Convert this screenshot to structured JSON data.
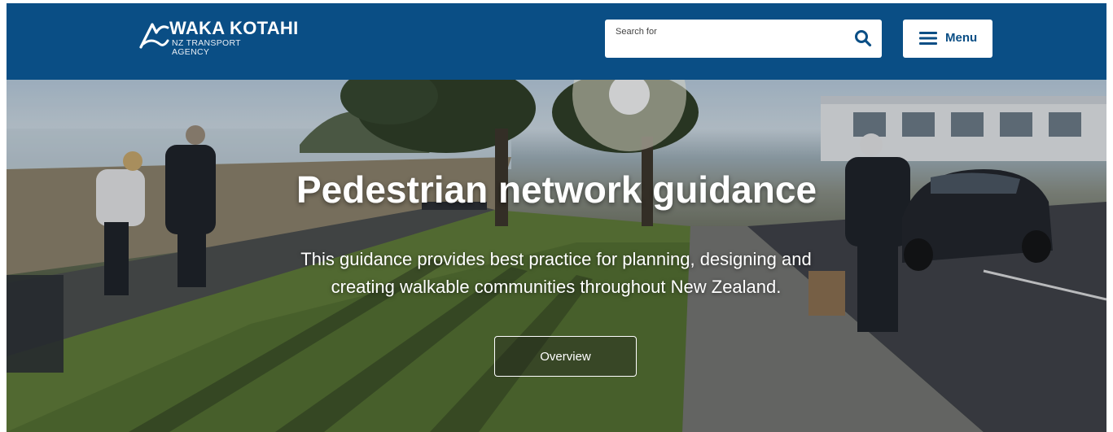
{
  "header": {
    "logo": {
      "name": "WAKA KOTAHI",
      "subtitle_line1": "NZ TRANSPORT",
      "subtitle_line2": "AGENCY"
    },
    "search": {
      "placeholder": "Search for",
      "icon": "search-icon"
    },
    "menu": {
      "label": "Menu",
      "icon": "hamburger-icon"
    }
  },
  "hero": {
    "title": "Pedestrian network guidance",
    "description": "This guidance provides best practice for planning, designing and creating walkable communities throughout New Zealand.",
    "button_label": "Overview"
  },
  "colors": {
    "brand": "#0a4e85",
    "white": "#ffffff"
  }
}
